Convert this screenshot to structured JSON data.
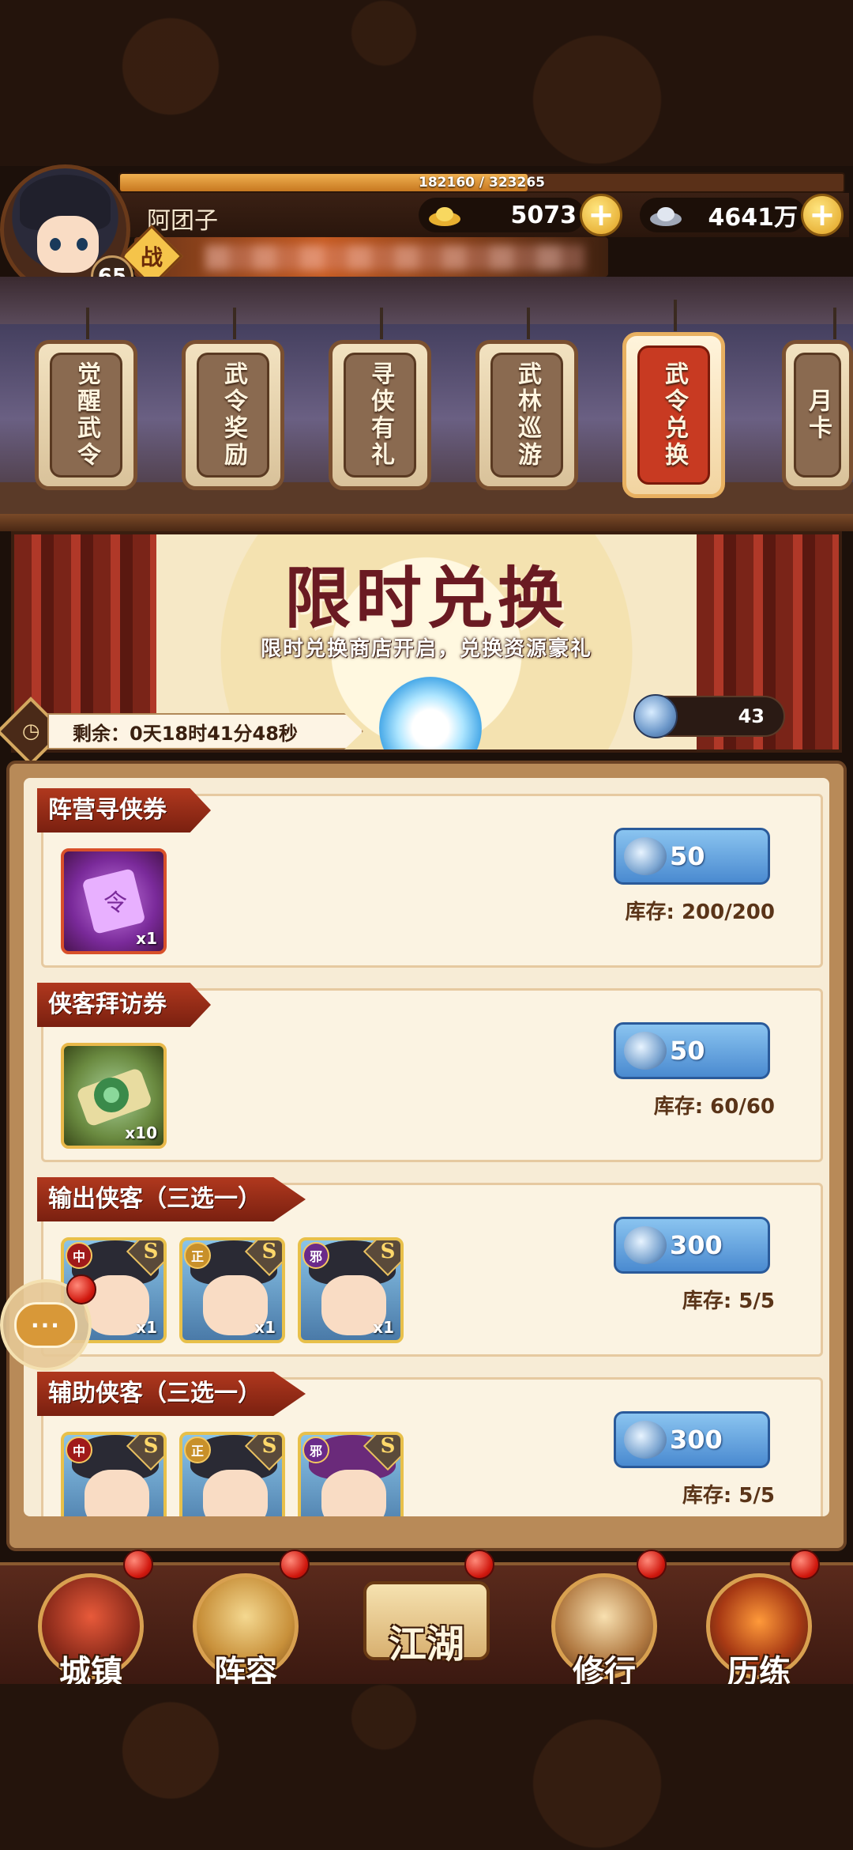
{
  "player": {
    "name": "阿团子",
    "level": "65",
    "exp_text": "182160 / 323265",
    "exp_ratio": 0.5635,
    "power_label": "战"
  },
  "currencies": {
    "gold": {
      "icon": "gold-ingot-icon",
      "value": "5073"
    },
    "silver": {
      "icon": "silver-ingot-icon",
      "value": "4641万"
    }
  },
  "tabs": [
    {
      "label": "觉醒武令",
      "active": false
    },
    {
      "label": "武令奖励",
      "active": false
    },
    {
      "label": "寻侠有礼",
      "active": false
    },
    {
      "label": "武林巡游",
      "active": false
    },
    {
      "label": "武令兑换",
      "active": true
    },
    {
      "label": "月卡",
      "active": false
    }
  ],
  "banner": {
    "title": "限时兑换",
    "subtitle": "限时兑换商店开启，兑换资源豪礼",
    "token_count": "43",
    "timer_text": "剩余：0天18时41分48秒"
  },
  "items": [
    {
      "title": "阵营寻侠券",
      "rewards": [
        {
          "type": "scroll-purple",
          "count": "x1"
        }
      ],
      "price": "50",
      "stock": "库存: 200/200"
    },
    {
      "title": "侠客拜访券",
      "rewards": [
        {
          "type": "scroll-green",
          "count": "x10"
        }
      ],
      "price": "50",
      "stock": "库存: 60/60"
    },
    {
      "title": "输出侠客（三选一）",
      "rewards": [
        {
          "type": "hero",
          "faction": "中",
          "rank": "S",
          "count": "x1"
        },
        {
          "type": "hero",
          "faction": "正",
          "rank": "S",
          "count": "x1"
        },
        {
          "type": "hero",
          "faction": "邪",
          "rank": "S",
          "count": "x1"
        }
      ],
      "price": "300",
      "stock": "库存: 5/5"
    },
    {
      "title": "辅助侠客（三选一）",
      "rewards": [
        {
          "type": "hero",
          "faction": "中",
          "rank": "S"
        },
        {
          "type": "hero",
          "faction": "正",
          "rank": "S"
        },
        {
          "type": "hero",
          "faction": "邪",
          "rank": "S"
        }
      ],
      "price": "300",
      "stock": "库存: 5/5"
    }
  ],
  "chat": {
    "label": "···"
  },
  "nav": [
    {
      "label": "城镇"
    },
    {
      "label": "阵容"
    },
    {
      "label": "江湖"
    },
    {
      "label": "修行"
    },
    {
      "label": "历练"
    }
  ],
  "colors": {
    "tab_active": "#c83a22",
    "buy_button": "#4a8ad0",
    "item_title": "#b0381e",
    "notification": "#d0180e"
  }
}
